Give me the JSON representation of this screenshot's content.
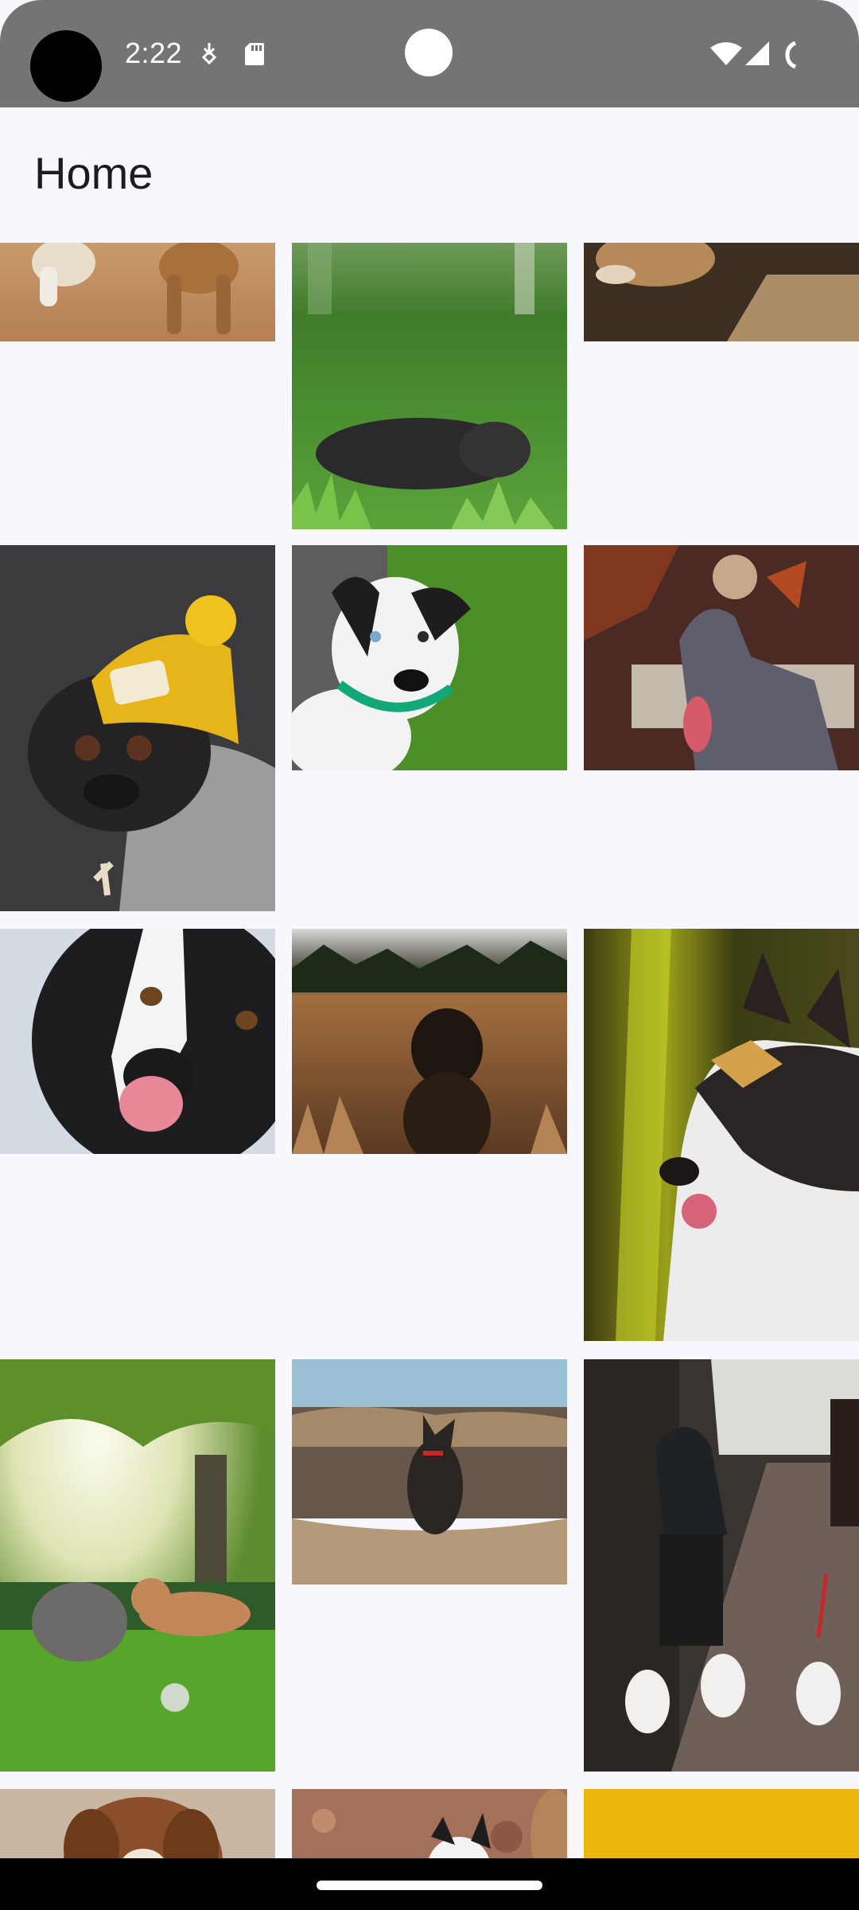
{
  "status_bar": {
    "time": "2:22",
    "icons": [
      "download-indicator-icon",
      "sd-card-icon",
      "wifi-icon",
      "cellular-signal-icon",
      "battery-icon"
    ]
  },
  "app_bar": {
    "title": "Home"
  },
  "gallery": {
    "items": [
      {
        "name": "photo-dogs-running-on-path",
        "palette": [
          "#b98a5e",
          "#d7b08a"
        ]
      },
      {
        "name": "photo-black-dog-lying-in-grass",
        "palette": [
          "#3f7a2c",
          "#2a2a2a"
        ]
      },
      {
        "name": "photo-dog-lying-in-sunlight",
        "palette": [
          "#4a3a2a",
          "#c9a77a"
        ]
      },
      {
        "name": "photo-pug-in-yellow-beanie",
        "palette": [
          "#3a3a3a",
          "#e6b51a"
        ]
      },
      {
        "name": "photo-spotted-dog-on-lawn",
        "palette": [
          "#4f8f2a",
          "#e8e8e8"
        ]
      },
      {
        "name": "photo-greyhound-under-autumn-leaves",
        "palette": [
          "#5a3a30",
          "#6e6c7a"
        ]
      },
      {
        "name": "photo-border-collie-licking-nose",
        "palette": [
          "#1a1a1a",
          "#f0f0f0"
        ]
      },
      {
        "name": "photo-dog-in-wheat-field",
        "palette": [
          "#a36a3a",
          "#1f1a14"
        ]
      },
      {
        "name": "photo-husky-with-leaf",
        "palette": [
          "#6b6a14",
          "#dcdcdc"
        ]
      },
      {
        "name": "photo-two-small-dogs-under-tree",
        "palette": [
          "#6ba13a",
          "#f2efe0"
        ]
      },
      {
        "name": "photo-dog-on-cliff-edge",
        "palette": [
          "#9bc1d6",
          "#8a7256"
        ]
      },
      {
        "name": "photo-woman-walking-three-poodles",
        "palette": [
          "#3a342f",
          "#f2f2f2"
        ]
      },
      {
        "name": "photo-long-haired-dog-portrait",
        "palette": [
          "#8a4f2a",
          "#c5a88a"
        ]
      },
      {
        "name": "photo-dog-in-autumn-leaves",
        "palette": [
          "#a06a52",
          "#f3f3f3"
        ]
      },
      {
        "name": "photo-yellow-backdrop",
        "palette": [
          "#edb70c",
          "#edb70c"
        ]
      }
    ]
  }
}
